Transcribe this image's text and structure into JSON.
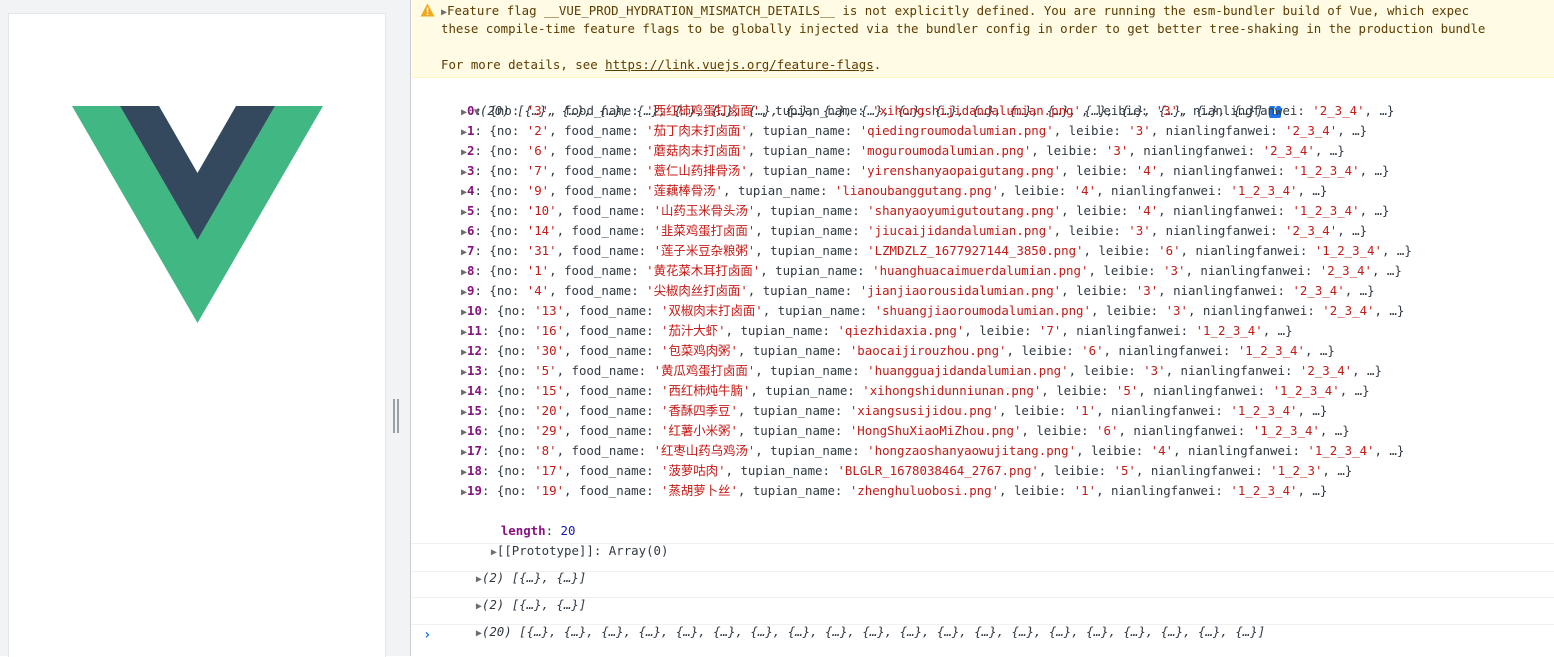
{
  "warning": {
    "line1": "Feature flag __VUE_PROD_HYDRATION_MISMATCH_DETAILS__ is not explicitly defined. You are running the esm-bundler build of Vue, which expec",
    "line2": "these compile-time feature flags to be globally injected via the bundler config in order to get better tree-shaking in the production bundle",
    "more_prefix": "For more details, see ",
    "link": "https://link.vuejs.org/feature-flags",
    "more_suffix": "."
  },
  "array_header": "(20) [{…}, {…}, {…}, {…}, {…}, {…}, {…}, {…}, {…}, {…}, {…}, {…}, {…}, {…}, {…}, {…}, {…}, {…}, {…}, {…}]",
  "items": [
    {
      "idx": "0",
      "no": "3",
      "food_name": "西红柿鸡蛋打卤面",
      "tupian_name": "xihongshijidandalumian.png",
      "leibie": "3",
      "nianlingfanwei": "2_3_4"
    },
    {
      "idx": "1",
      "no": "2",
      "food_name": "茄丁肉末打卤面",
      "tupian_name": "qiedingroumodalumian.png",
      "leibie": "3",
      "nianlingfanwei": "2_3_4"
    },
    {
      "idx": "2",
      "no": "6",
      "food_name": "蘑菇肉末打卤面",
      "tupian_name": "moguroumodalumian.png",
      "leibie": "3",
      "nianlingfanwei": "2_3_4"
    },
    {
      "idx": "3",
      "no": "7",
      "food_name": "薏仁山药排骨汤",
      "tupian_name": "yirenshanyaopaigutang.png",
      "leibie": "4",
      "nianlingfanwei": "1_2_3_4"
    },
    {
      "idx": "4",
      "no": "9",
      "food_name": "莲藕棒骨汤",
      "tupian_name": "lianoubanggutang.png",
      "leibie": "4",
      "nianlingfanwei": "1_2_3_4"
    },
    {
      "idx": "5",
      "no": "10",
      "food_name": "山药玉米骨头汤",
      "tupian_name": "shanyaoyumigutoutang.png",
      "leibie": "4",
      "nianlingfanwei": "1_2_3_4"
    },
    {
      "idx": "6",
      "no": "14",
      "food_name": "韭菜鸡蛋打卤面",
      "tupian_name": "jiucaijidandalumian.png",
      "leibie": "3",
      "nianlingfanwei": "2_3_4"
    },
    {
      "idx": "7",
      "no": "31",
      "food_name": "莲子米豆杂粮粥",
      "tupian_name": "LZMDZLZ_1677927144_3850.png",
      "leibie": "6",
      "nianlingfanwei": "1_2_3_4"
    },
    {
      "idx": "8",
      "no": "1",
      "food_name": "黄花菜木耳打卤面",
      "tupian_name": "huanghuacaimuerdalumian.png",
      "leibie": "3",
      "nianlingfanwei": "2_3_4"
    },
    {
      "idx": "9",
      "no": "4",
      "food_name": "尖椒肉丝打卤面",
      "tupian_name": "jianjiaorousidalumian.png",
      "leibie": "3",
      "nianlingfanwei": "2_3_4"
    },
    {
      "idx": "10",
      "no": "13",
      "food_name": "双椒肉末打卤面",
      "tupian_name": "shuangjiaoroumodalumian.png",
      "leibie": "3",
      "nianlingfanwei": "2_3_4"
    },
    {
      "idx": "11",
      "no": "16",
      "food_name": "茄汁大虾",
      "tupian_name": "qiezhidaxia.png",
      "leibie": "7",
      "nianlingfanwei": "1_2_3_4"
    },
    {
      "idx": "12",
      "no": "30",
      "food_name": "包菜鸡肉粥",
      "tupian_name": "baocaijirouzhou.png",
      "leibie": "6",
      "nianlingfanwei": "1_2_3_4"
    },
    {
      "idx": "13",
      "no": "5",
      "food_name": "黄瓜鸡蛋打卤面",
      "tupian_name": "huangguajidandalumian.png",
      "leibie": "3",
      "nianlingfanwei": "2_3_4"
    },
    {
      "idx": "14",
      "no": "15",
      "food_name": "西红柿炖牛腩",
      "tupian_name": "xihongshidunniunan.png",
      "leibie": "5",
      "nianlingfanwei": "1_2_3_4"
    },
    {
      "idx": "15",
      "no": "20",
      "food_name": "香酥四季豆",
      "tupian_name": "xiangsusijidou.png",
      "leibie": "1",
      "nianlingfanwei": "1_2_3_4"
    },
    {
      "idx": "16",
      "no": "29",
      "food_name": "红薯小米粥",
      "tupian_name": "HongShuXiaoMiZhou.png",
      "leibie": "6",
      "nianlingfanwei": "1_2_3_4"
    },
    {
      "idx": "17",
      "no": "8",
      "food_name": "红枣山药乌鸡汤",
      "tupian_name": "hongzaoshanyaowujitang.png",
      "leibie": "4",
      "nianlingfanwei": "1_2_3_4"
    },
    {
      "idx": "18",
      "no": "17",
      "food_name": "菠萝咕肉",
      "tupian_name": "BLGLR_1678038464_2767.png",
      "leibie": "5",
      "nianlingfanwei": "1_2_3"
    },
    {
      "idx": "19",
      "no": "19",
      "food_name": "蒸胡萝卜丝",
      "tupian_name": "zhenghuluobosi.png",
      "leibie": "1",
      "nianlingfanwei": "1_2_3_4"
    }
  ],
  "length_label": "length",
  "length_value": "20",
  "prototype_label": "[[Prototype]]",
  "prototype_value": "Array(0)",
  "logs": [
    "(2) [{…}, {…}]",
    "(2) [{…}, {…}]",
    "(20) [{…}, {…}, {…}, {…}, {…}, {…}, {…}, {…}, {…}, {…}, {…}, {…}, {…}, {…}, {…}, {…}, {…}, {…}, {…}, {…}]"
  ],
  "prompt": "›",
  "colors": {
    "vue_green": "#41b883",
    "vue_dark": "#34495e",
    "warn_bg": "#fffbe5"
  }
}
